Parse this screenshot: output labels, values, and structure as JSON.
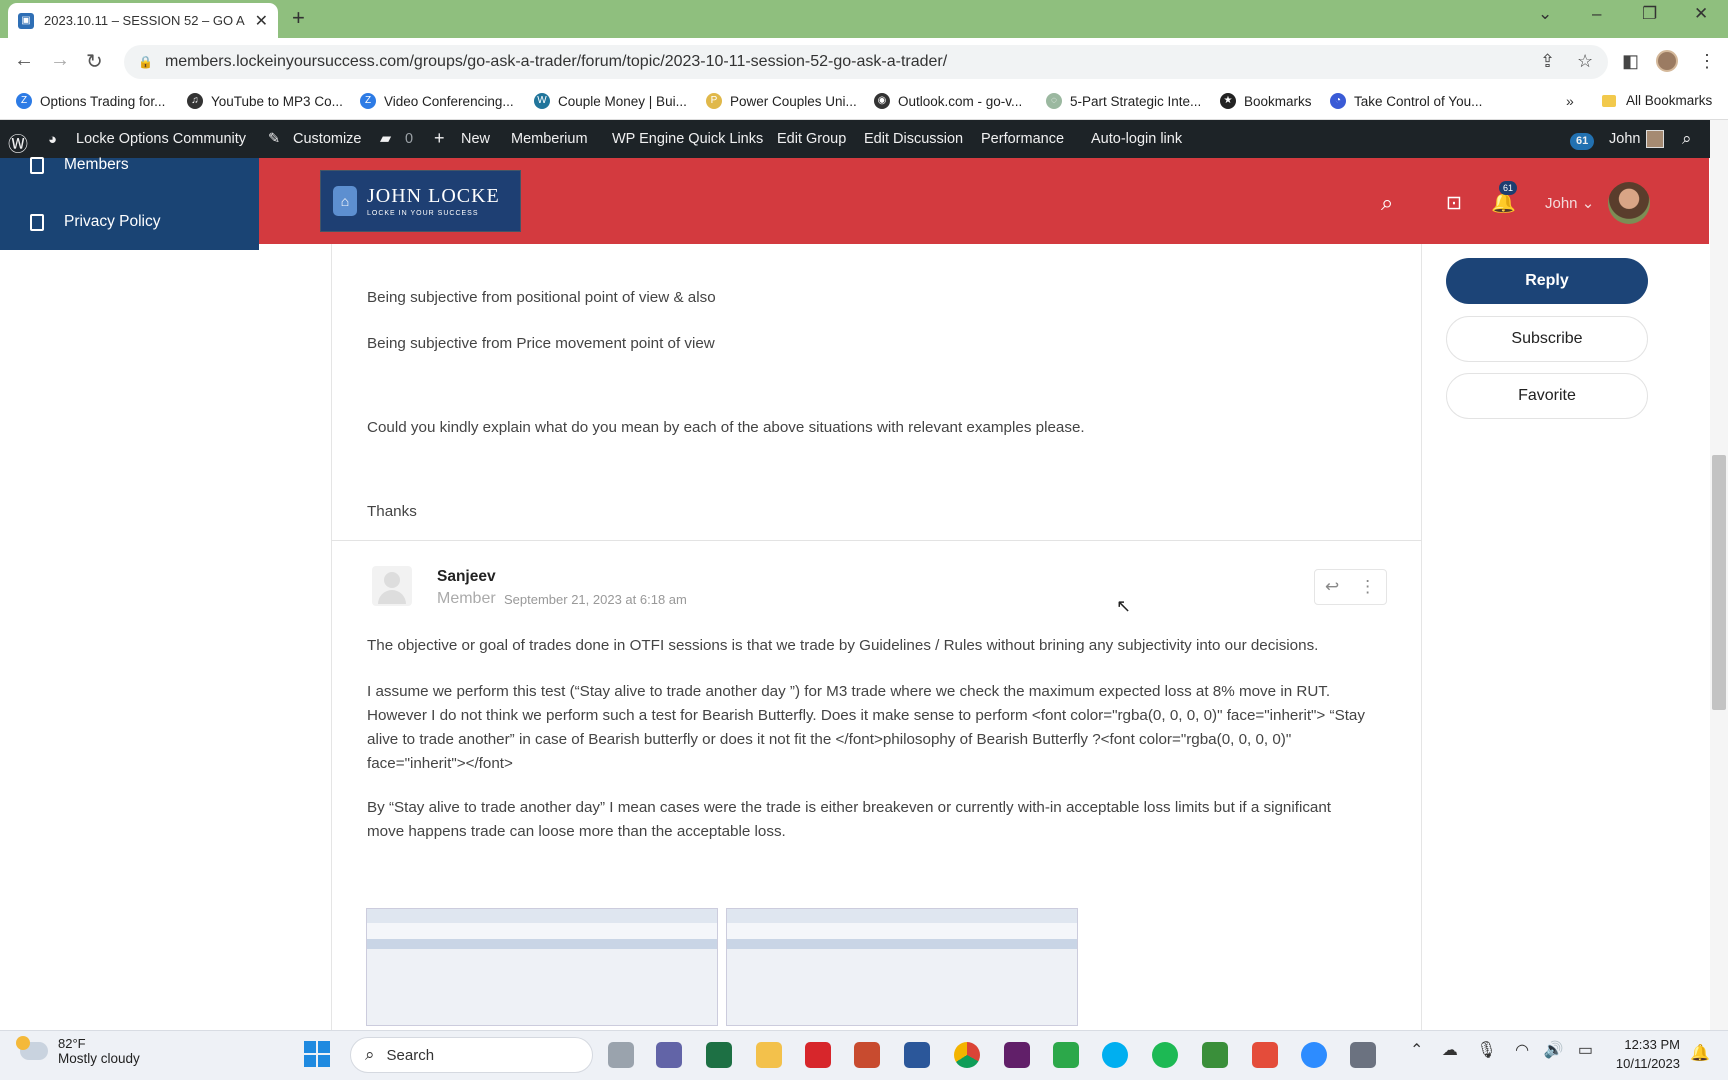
{
  "browser": {
    "tab_title": "2023.10.11 – SESSION 52 – GO A",
    "url": "members.lockeinyoursuccess.com/groups/go-ask-a-trader/forum/topic/2023-10-11-session-52-go-ask-a-trader/",
    "bookmarks": [
      {
        "label": "Options Trading for...",
        "color": "#2d7be5",
        "glyph": "Z"
      },
      {
        "label": "YouTube to MP3 Co...",
        "color": "#333333",
        "glyph": "♫"
      },
      {
        "label": "Video Conferencing...",
        "color": "#2d7be5",
        "glyph": "Z"
      },
      {
        "label": "Couple Money | Bui...",
        "color": "#21759b",
        "glyph": "W"
      },
      {
        "label": "Power Couples Uni...",
        "color": "#e0b84a",
        "glyph": "P"
      },
      {
        "label": "Outlook.com - go-v...",
        "color": "#333333",
        "glyph": "◉"
      },
      {
        "label": "5-Part Strategic Inte...",
        "color": "#9bb8a0",
        "glyph": "◌"
      },
      {
        "label": "Bookmarks",
        "color": "#222222",
        "glyph": "★"
      },
      {
        "label": "Take Control of You...",
        "color": "#3a5bd6",
        "glyph": "◔"
      }
    ],
    "more_bookmarks": "»",
    "all_bookmarks": "All Bookmarks"
  },
  "adminbar": {
    "site": "Locke Options Community",
    "customize": "Customize",
    "comments": "0",
    "new": "New",
    "memberium": "Memberium",
    "wpengine": "WP Engine Quick Links",
    "edit_group": "Edit Group",
    "edit_discussion": "Edit Discussion",
    "performance": "Performance",
    "autologin": "Auto-login link",
    "count": "61",
    "user": "John"
  },
  "leftmenu": {
    "members": "Members",
    "privacy": "Privacy Policy"
  },
  "header": {
    "logo_name": "JOHN LOCKE",
    "logo_tagline": "LOCKE IN YOUR SUCCESS",
    "notif_count": "61",
    "user": "John"
  },
  "post1": {
    "line1": "Being subjective from positional point of view & also",
    "line2": "Being subjective from Price movement point of view",
    "line3": "Could you kindly explain what do you mean by each of the above situations with relevant examples please.",
    "line4": "Thanks"
  },
  "post2": {
    "author": "Sanjeev",
    "role": "Member",
    "date": "September 21, 2023 at 6:18 am",
    "p1": "The objective or goal of trades done in OTFI sessions is that we trade by Guidelines / Rules without brining any subjectivity into our decisions.",
    "p2": "I assume we perform this test (“Stay alive to trade another day ”) for M3 trade where we check the maximum expected loss at 8% move in RUT. However I do not think we perform such a test for Bearish Butterfly. Does it make sense to perform <font color=\"rgba(0, 0, 0, 0)\" face=\"inherit\"> “Stay alive to trade another” in case of Bearish butterfly or does it not fit the </font>philosophy of Bearish Butterfly ?<font color=\"rgba(0, 0, 0, 0)\" face=\"inherit\"></font>",
    "p3": "By “Stay alive to trade another day” I mean cases were the trade is either breakeven or currently with-in acceptable loss limits but if a significant move happens trade can loose more than the acceptable loss."
  },
  "sidebar": {
    "reply": "Reply",
    "subscribe": "Subscribe",
    "favorite": "Favorite"
  },
  "taskbar": {
    "temp": "82°F",
    "condition": "Mostly cloudy",
    "search": "Search",
    "time": "12:33 PM",
    "date": "10/11/2023"
  },
  "colors": {
    "header_red": "#d33a3f",
    "nav_blue": "#1a4474",
    "reply_blue": "#1c4477",
    "tab_green": "#8fbf7e"
  }
}
